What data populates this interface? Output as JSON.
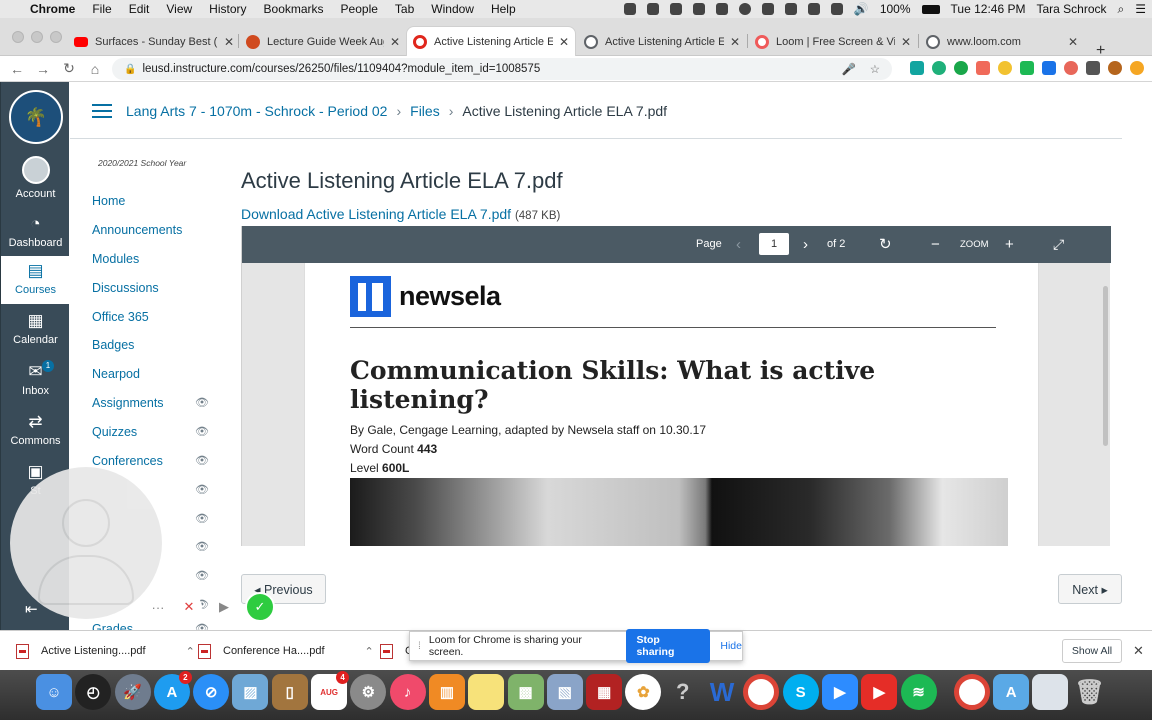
{
  "menubar": {
    "app": "Chrome",
    "items": [
      "File",
      "Edit",
      "View",
      "History",
      "Bookmarks",
      "People",
      "Tab",
      "Window",
      "Help"
    ],
    "battery": "100%",
    "clock": "Tue 12:46 PM",
    "user": "Tara Schrock"
  },
  "tabs": [
    {
      "title": "Surfaces - Sunday Best (L",
      "color": "#ff0000"
    },
    {
      "title": "Lecture Guide Week Aug",
      "color": "#d04a1f"
    },
    {
      "title": "Active Listening Article EL",
      "color": "#e0271d"
    },
    {
      "title": "Active Listening Article EL",
      "color": "#5f6368"
    },
    {
      "title": "Loom | Free Screen & Vid",
      "color": "#ef5a5a"
    },
    {
      "title": "www.loom.com",
      "color": "#5f6368"
    }
  ],
  "address": {
    "url": "leusd.instructure.com/courses/26250/files/1109404?module_item_id=1008575"
  },
  "global_nav": {
    "account": "Account",
    "dashboard": "Dashboard",
    "courses": "Courses",
    "calendar": "Calendar",
    "inbox": "Inbox",
    "inbox_badge": "1",
    "commons": "Commons",
    "studio": "St"
  },
  "breadcrumb": {
    "course": "Lang Arts 7 - 1070m - Schrock - Period 02",
    "files": "Files",
    "current": "Active Listening Article ELA 7.pdf"
  },
  "course_nav": {
    "year": "2020/2021 School Year",
    "items": [
      "Home",
      "Announcements",
      "Modules",
      "Discussions",
      "Office 365",
      "Badges",
      "Nearpod",
      "Assignments",
      "Quizzes",
      "Conferences"
    ],
    "partial": "Grades"
  },
  "file": {
    "title": "Active Listening Article ELA 7.pdf",
    "download": "Download Active Listening Article ELA 7.pdf",
    "size": "(487 KB)"
  },
  "viewer": {
    "page_label": "Page",
    "page_value": "1",
    "of_total": "of 2",
    "zoom_label": "ZOOM"
  },
  "article": {
    "brand": "newsela",
    "headline": "Communication Skills: What is active listening?",
    "byline": "By Gale, Cengage Learning, adapted by Newsela staff on 10.30.17",
    "wordcount_label": "Word Count",
    "wordcount": "443",
    "level_label": "Level",
    "level": "600L"
  },
  "pager": {
    "previous": "◂ Previous",
    "next": "Next ▸"
  },
  "downloads": {
    "items": [
      "Active Listening....pdf",
      "Conference Ha....pdf",
      "C"
    ],
    "show_all": "Show All"
  },
  "loom_bar": {
    "message": "Loom for Chrome is sharing your screen.",
    "stop": "Stop sharing",
    "hide": "Hide"
  },
  "dock": {
    "badges": {
      "appstore": "2",
      "calendar_date": "4"
    },
    "calendar_month": "AUG"
  }
}
